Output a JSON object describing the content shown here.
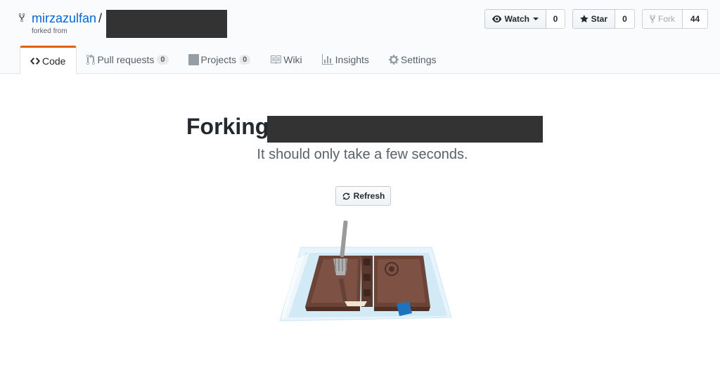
{
  "repo": {
    "owner": "mirzazulfan",
    "separator": "/",
    "forked_from_label": "forked from"
  },
  "actions": {
    "watch_label": "Watch",
    "watch_count": "0",
    "star_label": "Star",
    "star_count": "0",
    "fork_label": "Fork",
    "fork_count": "44"
  },
  "tabs": [
    {
      "label": "Code"
    },
    {
      "label": "Pull requests",
      "count": "0"
    },
    {
      "label": "Projects",
      "count": "0"
    },
    {
      "label": "Wiki"
    },
    {
      "label": "Insights"
    },
    {
      "label": "Settings"
    }
  ],
  "main": {
    "title_prefix": "Forking",
    "subtitle": "It should only take a few seconds.",
    "refresh_label": "Refresh"
  },
  "icons": {
    "repo_fork": "repo-forked-icon",
    "watch": "eye-icon",
    "star": "star-icon",
    "fork": "repo-forked-icon",
    "code": "code-icon",
    "pull_requests": "git-pull-request-icon",
    "projects": "project-icon",
    "wiki": "book-icon",
    "insights": "graph-icon",
    "settings": "gear-icon",
    "refresh": "sync-icon"
  },
  "colors": {
    "link": "#0366d6",
    "tab_accent": "#e36209",
    "header_bg": "#fafbfc",
    "redaction": "#333333"
  }
}
